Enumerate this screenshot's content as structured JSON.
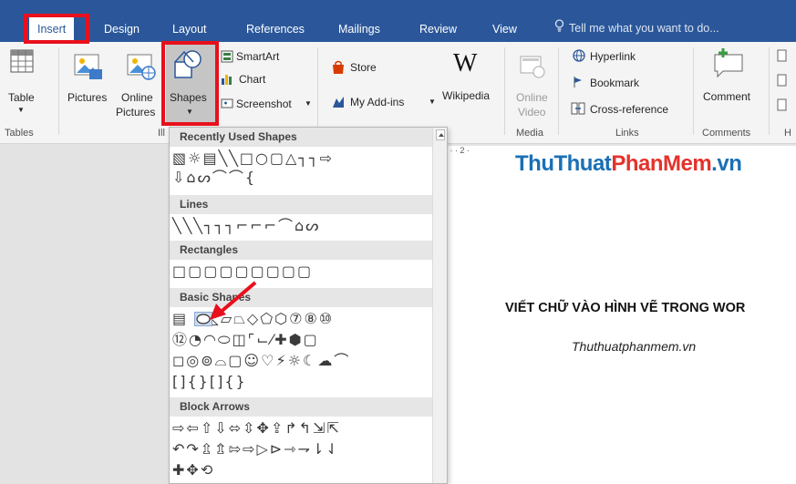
{
  "tabs": {
    "insert": "Insert",
    "design": "Design",
    "layout": "Layout",
    "references": "References",
    "mailings": "Mailings",
    "review": "Review",
    "view": "View",
    "tell_me": "Tell me what you want to do..."
  },
  "ribbon": {
    "table": "Table",
    "pictures": "Pictures",
    "online_pictures_1": "Online",
    "online_pictures_2": "Pictures",
    "shapes": "Shapes",
    "smartart": "SmartArt",
    "chart": "Chart",
    "screenshot": "Screenshot",
    "store": "Store",
    "my_addins": "My Add-ins",
    "wikipedia": "Wikipedia",
    "online_video_1": "Online",
    "online_video_2": "Video",
    "hyperlink": "Hyperlink",
    "bookmark": "Bookmark",
    "cross_reference": "Cross-reference",
    "comment": "Comment",
    "groups": {
      "tables": "Tables",
      "illustrations": "Ill",
      "media": "Media",
      "links": "Links",
      "comments": "Comments",
      "header": "H"
    }
  },
  "gallery": {
    "sections": {
      "recent": "Recently Used Shapes",
      "lines": "Lines",
      "rectangles": "Rectangles",
      "basic": "Basic Shapes",
      "block_arrows": "Block Arrows"
    },
    "rows": {
      "recent1": "▧☼▤╲╲□○▢△┐┐⇨",
      "recent2": "⇩⌂ᔕ⌒⌒{",
      "lines1": "╲╲╲┐┐┐⌐⌐⌐⌒⌂ᔕ",
      "rect1": "□▢▢▢▢▢▢▢▢",
      "basic1": "▤  △◺▱⏢◇⬠⬡⑦⑧⑩",
      "basic2": "⑫◔◠⬭◫⌜⌙⁄✚⬢▢",
      "basic3": "◻◎⊚⌓▢☺♡⚡☼☾☁⌒",
      "basic4": "[]{}[]{}",
      "arrows1": "⇨⇦⇧⇩⬄⇳✥⇪↱↰⇲⇱",
      "arrows2": "↶↷⇫⇬⇰⇨▷⊳⇾⇁⇂⇃",
      "arrows3": "✚✥⟲"
    }
  },
  "document": {
    "ruler": "· · · 2 ·",
    "brand_blue1": "ThuThuat",
    "brand_red": "PhanMem",
    "brand_blue2": ".vn",
    "heading": "VIẾT CHỮ VÀO HÌNH VẼ TRONG WOR",
    "subtitle": "Thuthuatphanmem.vn"
  },
  "colors": {
    "tab_bar": "#2b579a",
    "highlight_box": "#e8101c",
    "brand_blue": "#1a6fb5",
    "brand_red": "#e3332c"
  }
}
